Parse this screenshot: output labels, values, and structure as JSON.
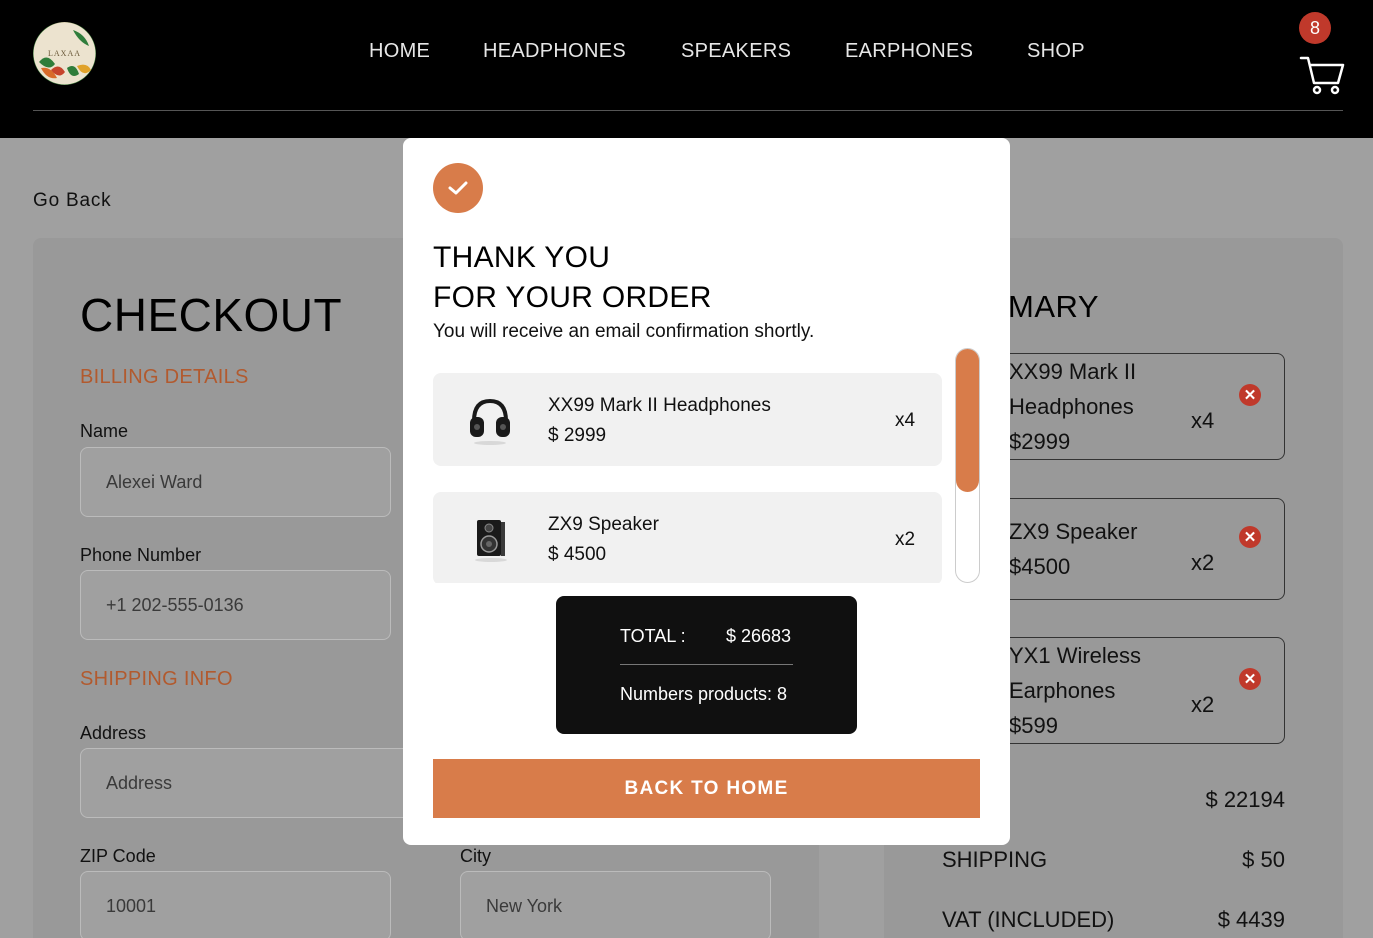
{
  "header": {
    "nav": [
      "HOME",
      "HEADPHONES",
      "SPEAKERS",
      "EARPHONES",
      "SHOP"
    ],
    "cart_count": "8",
    "logo_text": "LAXAA"
  },
  "page": {
    "go_back": "Go Back"
  },
  "checkout": {
    "title": "CHECKOUT",
    "billing_label": "BILLING DETAILS",
    "shipping_label": "SHIPPING INFO",
    "name_label": "Name",
    "name_value": "Alexei Ward",
    "phone_label": "Phone Number",
    "phone_value": "+1 202-555-0136",
    "address_label": "Address",
    "address_placeholder": "Address",
    "zip_label": "ZIP Code",
    "zip_value": "10001",
    "city_label": "City",
    "city_value": "New York"
  },
  "summary": {
    "title_visible": "MARY",
    "items": [
      {
        "name_lines": [
          "XX99 Mark II",
          "Headphones",
          "$2999"
        ],
        "qty": "x4"
      },
      {
        "name_lines": [
          "ZX9 Speaker",
          "$4500"
        ],
        "qty": "x2"
      },
      {
        "name_lines": [
          "YX1 Wireless",
          "Earphones",
          "$599"
        ],
        "qty": "x2"
      }
    ],
    "total_value": "$ 22194",
    "shipping_label": "SHIPPING",
    "shipping_value": "$ 50",
    "vat_label": "VAT (INCLUDED)",
    "vat_value": "$ 4439"
  },
  "modal": {
    "title_line1": "THANK YOU",
    "title_line2": "FOR YOUR ORDER",
    "subtitle": "You will receive an email confirmation shortly.",
    "items": [
      {
        "name": "XX99 Mark II Headphones",
        "price": "$ 2999",
        "qty": "x4",
        "icon": "headphones-icon"
      },
      {
        "name": "ZX9 Speaker",
        "price": "$ 4500",
        "qty": "x2",
        "icon": "speaker-icon"
      }
    ],
    "total_label": "TOTAL :",
    "total_value": "$ 26683",
    "num_products": "Numbers products: 8",
    "back_button": "BACK TO HOME",
    "scroll_position": 0.0,
    "colors": {
      "accent": "#d87c4a",
      "dark": "#101010"
    }
  }
}
